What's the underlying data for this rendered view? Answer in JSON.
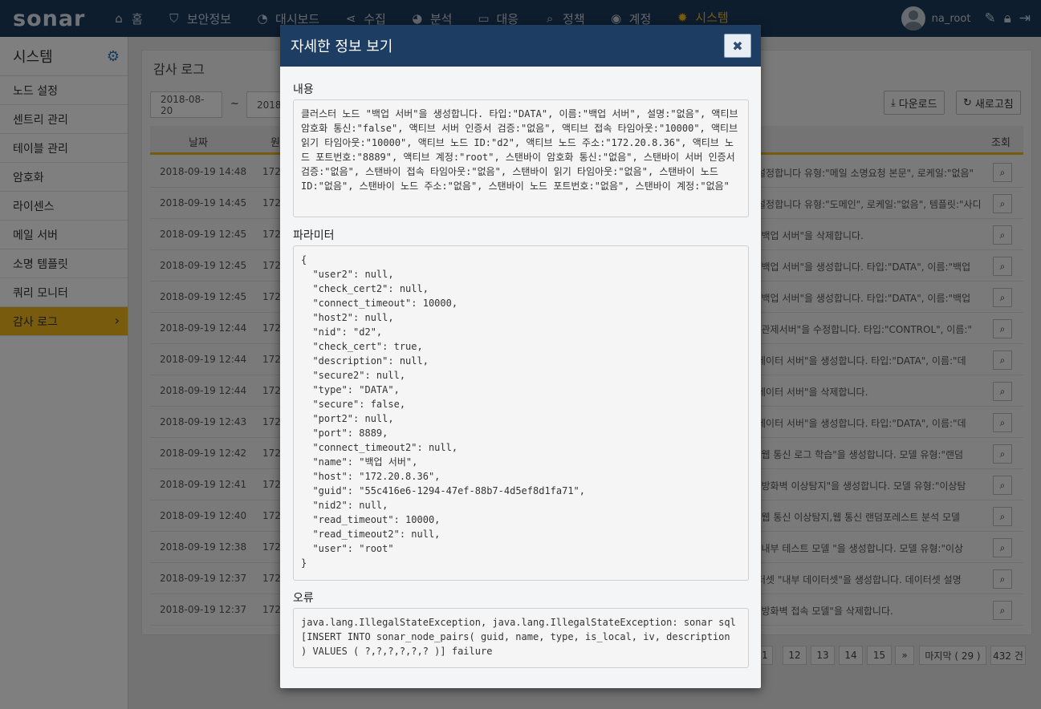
{
  "app": {
    "logo": "sonar"
  },
  "nav": {
    "items": [
      {
        "label": "홈",
        "icon": "home-icon",
        "glyph": "⌂"
      },
      {
        "label": "보안정보",
        "icon": "shield-icon",
        "glyph": "⛉"
      },
      {
        "label": "대시보드",
        "icon": "dashboard-icon",
        "glyph": "◔"
      },
      {
        "label": "수집",
        "icon": "share-icon",
        "glyph": "⋖"
      },
      {
        "label": "분석",
        "icon": "pie-chart-icon",
        "glyph": "◕"
      },
      {
        "label": "대응",
        "icon": "laptop-icon",
        "glyph": "▭"
      },
      {
        "label": "정책",
        "icon": "search-icon",
        "glyph": "⌕"
      },
      {
        "label": "계정",
        "icon": "user-circle-icon",
        "glyph": "◉"
      },
      {
        "label": "시스템",
        "icon": "gear-icon",
        "glyph": "✹"
      }
    ],
    "active_index": 8,
    "username": "na_root"
  },
  "sidebar": {
    "title": "시스템",
    "items": [
      {
        "label": "노드 설정"
      },
      {
        "label": "센트리 관리"
      },
      {
        "label": "테이블 관리"
      },
      {
        "label": "암호화"
      },
      {
        "label": "라이센스"
      },
      {
        "label": "메일 서버"
      },
      {
        "label": "소명 템플릿"
      },
      {
        "label": "쿼리 모니터"
      },
      {
        "label": "감사 로그"
      }
    ],
    "active_index": 8
  },
  "main": {
    "title": "감사 로그",
    "date_from": "2018-08-20",
    "date_to_partial": "2018-",
    "date_separator": "~",
    "download_label": "다운로드",
    "refresh_label": "새로고침",
    "columns": {
      "date": "날짜",
      "source": "원",
      "view": "조회"
    },
    "rows": [
      {
        "date": "2018-09-19 14:48",
        "ip": "172.",
        "msg": "설정합니다 유형:\"메일 소명요청 본문\", 로케일:\"없음\""
      },
      {
        "date": "2018-09-19 14:45",
        "ip": "172.",
        "msg": "설정합니다 유형:\"도메인\", 로케일:\"없음\", 템플릿:\"사디"
      },
      {
        "date": "2018-09-19 12:45",
        "ip": "172.",
        "msg": "\"백업 서버\"을 삭제합니다."
      },
      {
        "date": "2018-09-19 12:45",
        "ip": "172.",
        "msg": "\"백업 서버\"을 생성합니다. 타입:\"DATA\", 이름:\"백업"
      },
      {
        "date": "2018-09-19 12:45",
        "ip": "172.",
        "msg": "\"백업 서버\"을 생성합니다. 타입:\"DATA\", 이름:\"백업"
      },
      {
        "date": "2018-09-19 12:44",
        "ip": "172.",
        "msg": "\"관제서버\"을 수정합니다. 타입:\"CONTROL\", 이름:\""
      },
      {
        "date": "2018-09-19 12:44",
        "ip": "172.",
        "msg": "데이터 서버\"을 생성합니다. 타입:\"DATA\", 이름:\"데"
      },
      {
        "date": "2018-09-19 12:44",
        "ip": "172.",
        "msg": "데이터 서버\"을 삭제합니다."
      },
      {
        "date": "2018-09-19 12:43",
        "ip": "172.",
        "msg": "데이터 서버\"을 생성합니다. 타입:\"DATA\", 이름:\"데"
      },
      {
        "date": "2018-09-19 12:42",
        "ip": "172.",
        "msg": "\"웹 통신 로그 학습\"을 생성합니다. 모델 유형:\"랜덤"
      },
      {
        "date": "2018-09-19 12:41",
        "ip": "172.",
        "msg": "\"방화벽 이상탐지\"을 생성합니다. 모델 유형:\"이상탐"
      },
      {
        "date": "2018-09-19 12:40",
        "ip": "172.",
        "msg": "\"웹 통신 이상탐지,웹 통신 랜덤포레스트 분석 모델"
      },
      {
        "date": "2018-09-19 12:38",
        "ip": "172.",
        "msg": "\"내부 테스트 모델 \"을 생성합니다. 모델 유형:\"이상"
      },
      {
        "date": "2018-09-19 12:37",
        "ip": "172.",
        "msg": "터셋 \"내부 데이터셋\"을 생성합니다. 데이터셋 설명"
      },
      {
        "date": "2018-09-19 12:37",
        "ip": "172.",
        "msg": "\"방화벽 접속 모델\"을 삭제합니다."
      }
    ],
    "pagination": {
      "pages": [
        "11",
        "12",
        "13",
        "14",
        "15"
      ],
      "next": "»",
      "last": "마지막 ( 29 )",
      "total": "432 건"
    }
  },
  "modal": {
    "title": "자세한 정보 보기",
    "content_label": "내용",
    "content_text": "클러스터 노드 \"백업 서버\"을 생성합니다. 타입:\"DATA\", 이름:\"백업 서버\", 설명:\"없음\", 액티브 암호화 통신:\"false\", 액티브 서버 인증서 검증:\"없음\", 액티브 접속 타임아웃:\"10000\", 액티브 읽기 타임아웃:\"10000\", 액티브 노드 ID:\"d2\", 액티브 노드 주소:\"172.20.8.36\", 액티브 노드 포트번호:\"8889\", 액티브 계정:\"root\", 스탠바이 암호화 통신:\"없음\", 스탠바이 서버 인증서 검증:\"없음\", 스탠바이 접속 타임아웃:\"없음\", 스탠바이 읽기 타임아웃:\"없음\", 스탠바이 노드 ID:\"없음\", 스탠바이 노드 주소:\"없음\", 스탠바이 노드 포트번호:\"없음\", 스탠바이 계정:\"없음\"",
    "params_label": "파라미터",
    "params_text": "{\n  \"user2\": null,\n  \"check_cert2\": null,\n  \"connect_timeout\": 10000,\n  \"host2\": null,\n  \"nid\": \"d2\",\n  \"check_cert\": true,\n  \"description\": null,\n  \"secure2\": null,\n  \"type\": \"DATA\",\n  \"secure\": false,\n  \"port2\": null,\n  \"port\": 8889,\n  \"connect_timeout2\": null,\n  \"name\": \"백업 서버\",\n  \"host\": \"172.20.8.36\",\n  \"guid\": \"55c416e6-1294-47ef-88b7-4d5ef8d1fa71\",\n  \"nid2\": null,\n  \"read_timeout\": 10000,\n  \"read_timeout2\": null,\n  \"user\": \"root\"\n}",
    "error_label": "오류",
    "error_text": "java.lang.IllegalStateException, java.lang.IllegalStateException: sonar sql [INSERT INTO sonar_node_pairs( guid, name, type, is_local, iv, description ) VALUES ( ?,?,?,?,?,? )] failure",
    "close_glyph": "✖"
  },
  "colors": {
    "nav_bg": "#1d3a5c",
    "accent": "#f3b71b",
    "modal_header": "#1d3d63"
  }
}
